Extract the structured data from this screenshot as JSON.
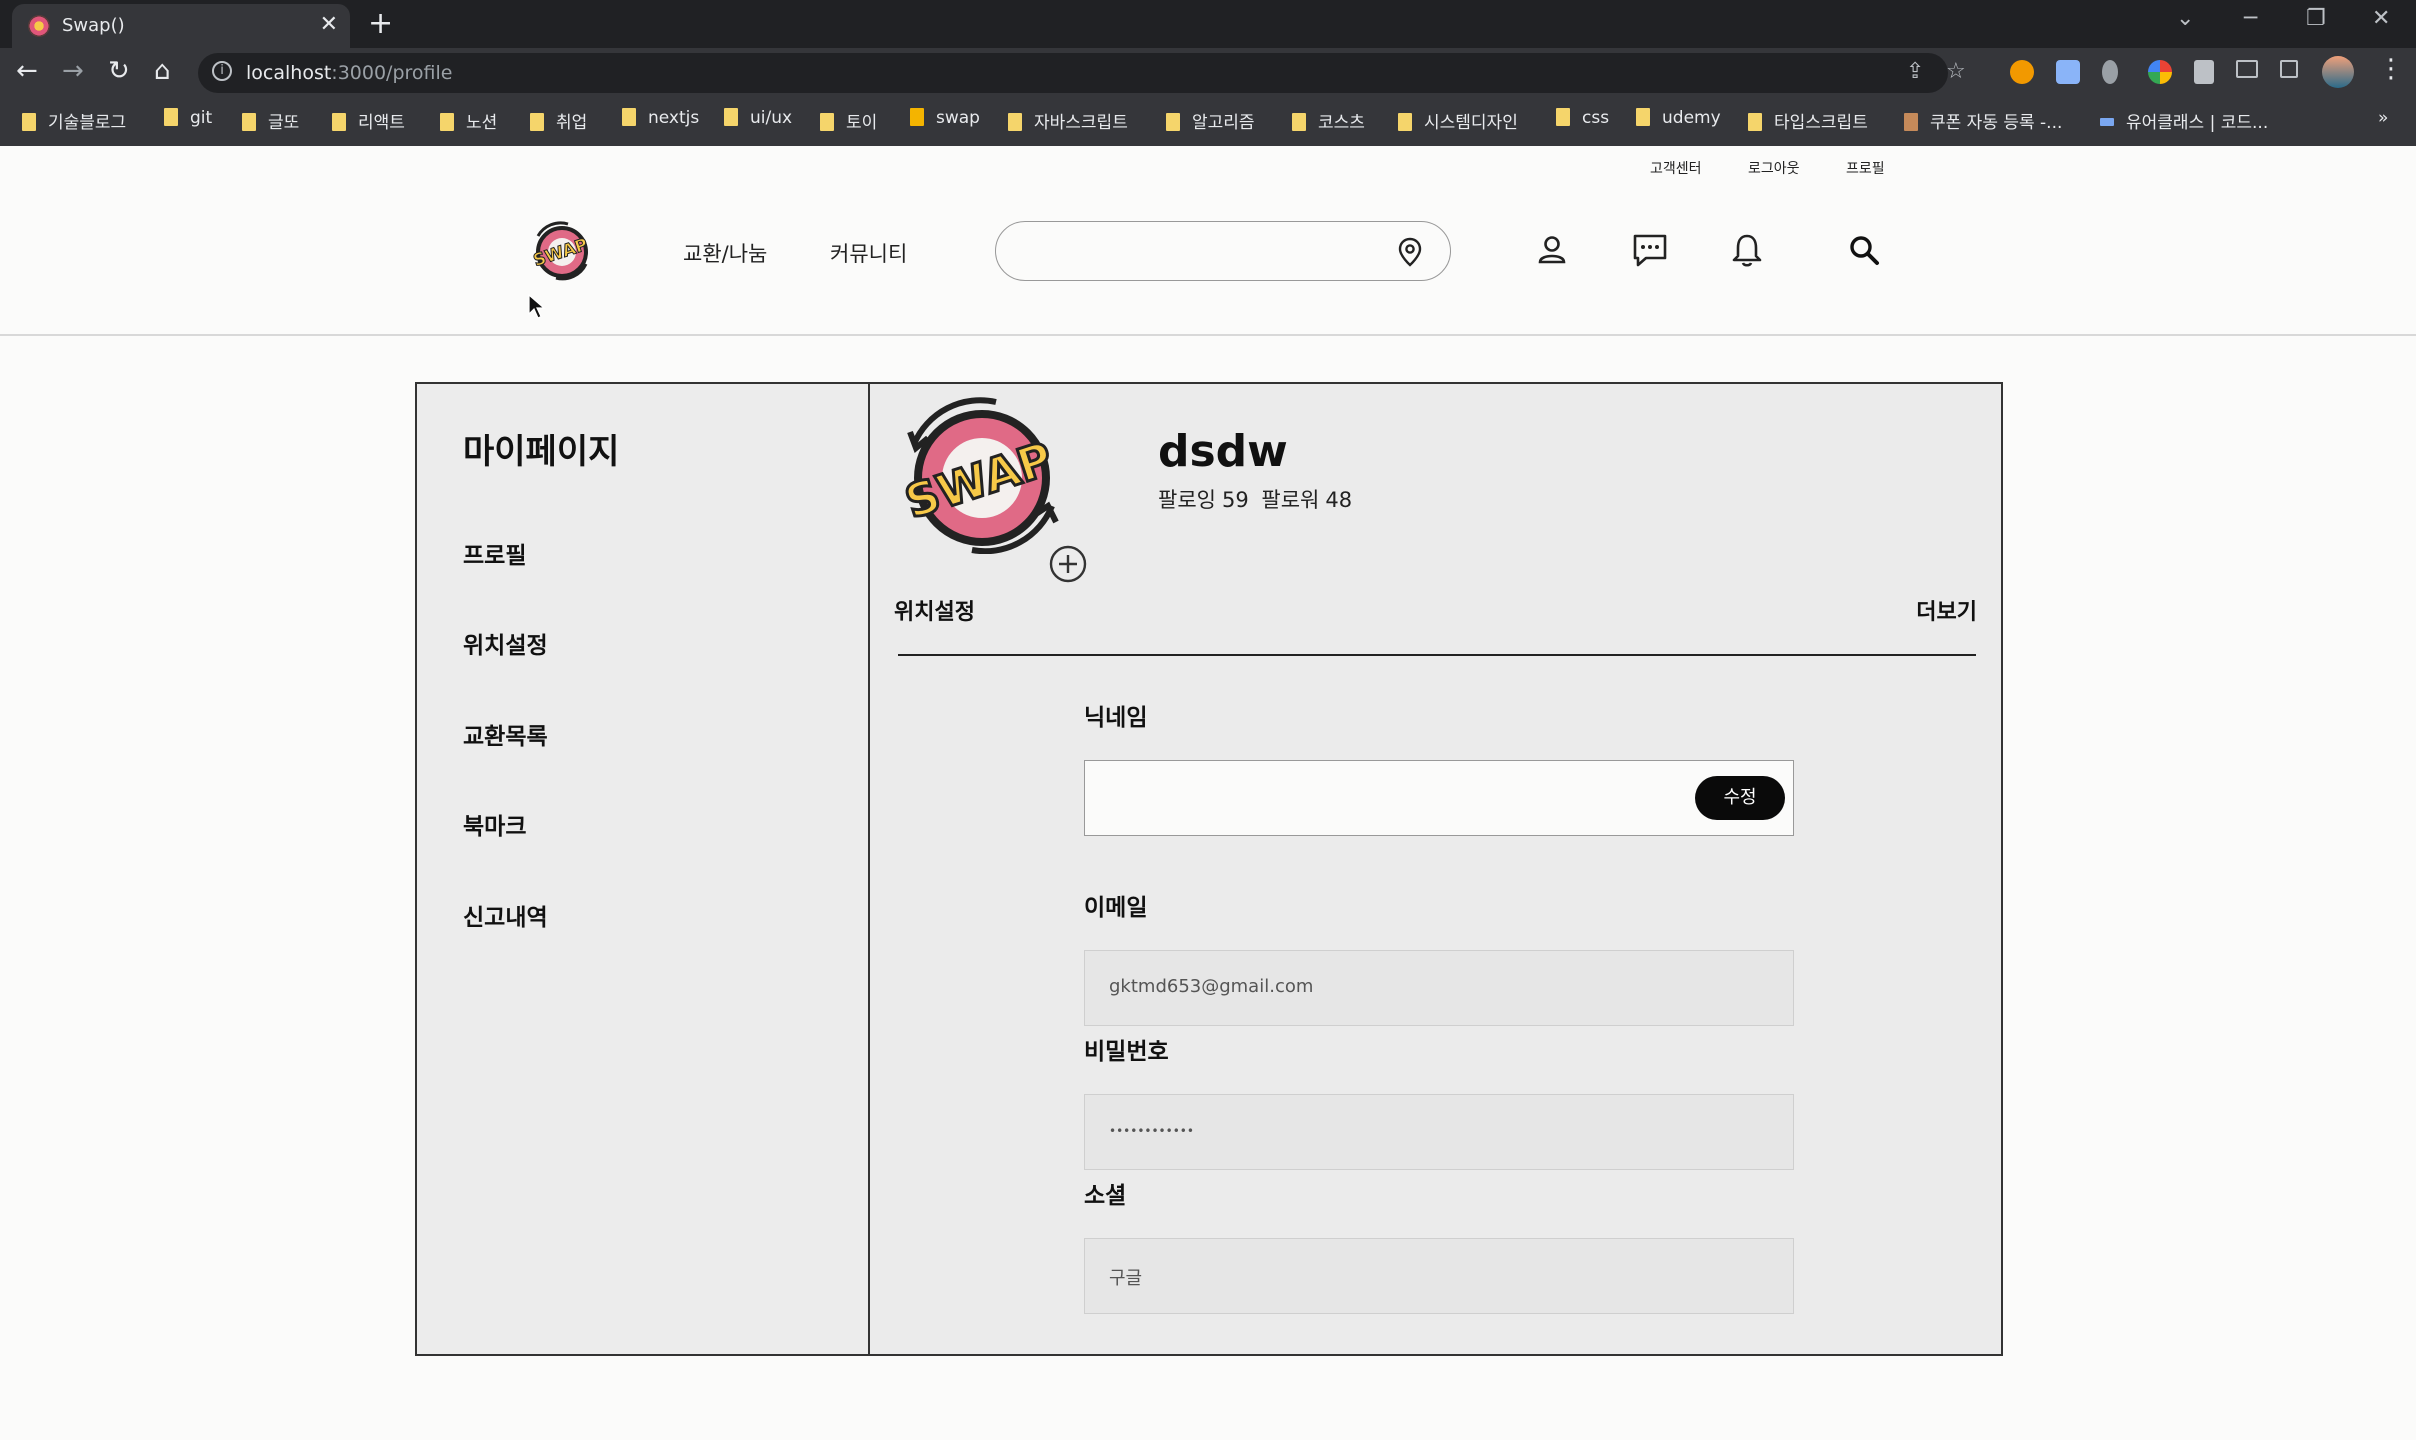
{
  "browser": {
    "tab_title": "Swap()",
    "url_host": "localhost",
    "url_path": ":3000/profile",
    "bookmarks": [
      "기술블로그",
      "git",
      "글또",
      "리액트",
      "노션",
      "취업",
      "nextjs",
      "ui/ux",
      "토이",
      "swap",
      "자바스크립트",
      "알고리즘",
      "코스츠",
      "시스템디자인",
      "css",
      "udemy",
      "타입스크립트",
      "쿠폰 자동 등록 -...",
      "유어클래스 | 코드..."
    ],
    "bookmarks_more": "»"
  },
  "header": {
    "util_links": [
      "고객센터",
      "로그아웃",
      "프로필"
    ],
    "nav": [
      "교환/나눔",
      "커뮤니티"
    ],
    "search_placeholder": "",
    "logo_text": "SWAP"
  },
  "sidebar": {
    "title": "마이페이지",
    "items": [
      "프로필",
      "위치설정",
      "교환목록",
      "북마크",
      "신고내역"
    ]
  },
  "profile": {
    "username": "dsdw",
    "following_label": "팔로잉",
    "following_count": "59",
    "followers_label": "팔로워",
    "followers_count": "48",
    "tab_left": "위치설정",
    "tab_right": "더보기"
  },
  "form": {
    "nickname_label": "닉네임",
    "nickname_value": "",
    "edit_button": "수정",
    "email_label": "이메일",
    "email_value": "gktmd653@gmail.com",
    "password_label": "비밀번호",
    "password_value": "••••••••••••",
    "social_label": "소셜",
    "social_value": "구글"
  }
}
